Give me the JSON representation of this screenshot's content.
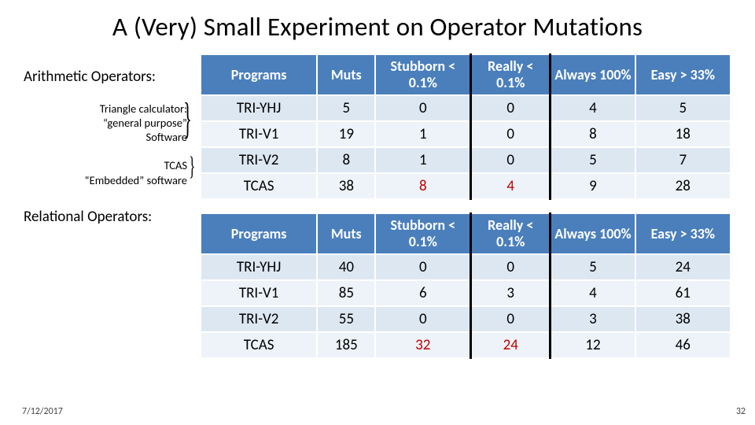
{
  "title": "A (Very) Small Experiment on Operator Mutations",
  "labels": {
    "arith": "Arithmetic Operators:",
    "rel": "Relational Operators:"
  },
  "notes": {
    "tri_l1": "Triangle calculator:",
    "tri_l2": "“general purpose”",
    "tri_l3": "Software",
    "tcas_l1": "TCAS",
    "tcas_l2": "“Embedded” software"
  },
  "headers": {
    "programs": "Programs",
    "muts": "Muts",
    "stubborn": "Stubborn < 0.1%",
    "really": "Really < 0.1%",
    "always": "Always 100%",
    "easy": "Easy > 33%"
  },
  "table_arith": [
    {
      "prog": "TRI-YHJ",
      "muts": "5",
      "stub": "0",
      "real": "0",
      "alw": "4",
      "easy": "5",
      "red": false
    },
    {
      "prog": "TRI-V1",
      "muts": "19",
      "stub": "1",
      "real": "0",
      "alw": "8",
      "easy": "18",
      "red": false
    },
    {
      "prog": "TRI-V2",
      "muts": "8",
      "stub": "1",
      "real": "0",
      "alw": "5",
      "easy": "7",
      "red": false
    },
    {
      "prog": "TCAS",
      "muts": "38",
      "stub": "8",
      "real": "4",
      "alw": "9",
      "easy": "28",
      "red": true
    }
  ],
  "table_rel": [
    {
      "prog": "TRI-YHJ",
      "muts": "40",
      "stub": "0",
      "real": "0",
      "alw": "5",
      "easy": "24",
      "red": false
    },
    {
      "prog": "TRI-V1",
      "muts": "85",
      "stub": "6",
      "real": "3",
      "alw": "4",
      "easy": "61",
      "red": false
    },
    {
      "prog": "TRI-V2",
      "muts": "55",
      "stub": "0",
      "real": "0",
      "alw": "3",
      "easy": "38",
      "red": false
    },
    {
      "prog": "TCAS",
      "muts": "185",
      "stub": "32",
      "real": "24",
      "alw": "12",
      "easy": "46",
      "red": true
    }
  ],
  "footer": {
    "date": "7/12/2017",
    "num": "32"
  },
  "chart_data": [
    {
      "type": "table",
      "title": "Arithmetic Operators",
      "columns": [
        "Programs",
        "Muts",
        "Stubborn < 0.1%",
        "Really < 0.1%",
        "Always 100%",
        "Easy > 33%"
      ],
      "rows": [
        [
          "TRI-YHJ",
          5,
          0,
          0,
          4,
          5
        ],
        [
          "TRI-V1",
          19,
          1,
          0,
          8,
          18
        ],
        [
          "TRI-V2",
          8,
          1,
          0,
          5,
          7
        ],
        [
          "TCAS",
          38,
          8,
          4,
          9,
          28
        ]
      ]
    },
    {
      "type": "table",
      "title": "Relational Operators",
      "columns": [
        "Programs",
        "Muts",
        "Stubborn < 0.1%",
        "Really < 0.1%",
        "Always 100%",
        "Easy > 33%"
      ],
      "rows": [
        [
          "TRI-YHJ",
          40,
          0,
          0,
          5,
          24
        ],
        [
          "TRI-V1",
          85,
          6,
          3,
          4,
          61
        ],
        [
          "TRI-V2",
          55,
          0,
          0,
          3,
          38
        ],
        [
          "TCAS",
          185,
          32,
          24,
          12,
          46
        ]
      ]
    }
  ]
}
